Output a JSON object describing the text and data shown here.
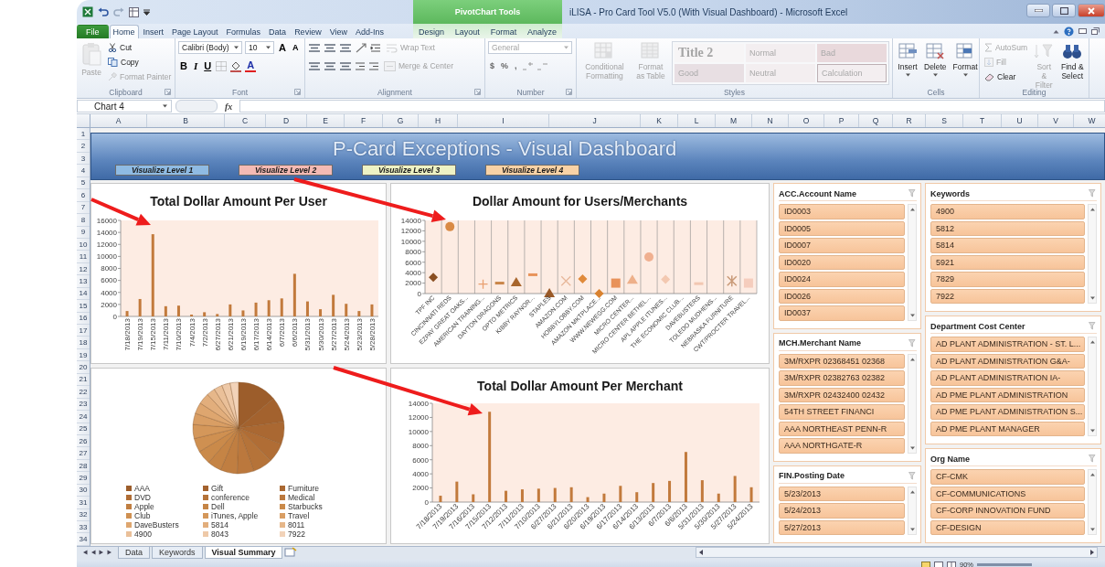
{
  "window": {
    "title": "iLISA - Pro Card Tool V5.0 (With Visual Dashboard) - Microsoft Excel",
    "context_label": "PivotChart Tools"
  },
  "ribbon_tabs": [
    {
      "label": "File",
      "kind": "file",
      "selected": false
    },
    {
      "label": "Home",
      "kind": "normal",
      "selected": true
    },
    {
      "label": "Insert",
      "kind": "normal",
      "selected": false
    },
    {
      "label": "Page Layout",
      "kind": "normal",
      "selected": false
    },
    {
      "label": "Formulas",
      "kind": "normal",
      "selected": false
    },
    {
      "label": "Data",
      "kind": "normal",
      "selected": false
    },
    {
      "label": "Review",
      "kind": "normal",
      "selected": false
    },
    {
      "label": "View",
      "kind": "normal",
      "selected": false
    },
    {
      "label": "Add-Ins",
      "kind": "normal",
      "selected": false
    },
    {
      "label": "Design",
      "kind": "context",
      "selected": false
    },
    {
      "label": "Layout",
      "kind": "context",
      "selected": false
    },
    {
      "label": "Format",
      "kind": "context",
      "selected": false
    },
    {
      "label": "Analyze",
      "kind": "context",
      "selected": false
    }
  ],
  "ribbon": {
    "clipboard": {
      "label": "Clipboard",
      "paste": {
        "label": "Paste",
        "disabled": true
      },
      "items": [
        {
          "label": "Cut",
          "disabled": false
        },
        {
          "label": "Copy",
          "disabled": false
        },
        {
          "label": "Format Painter",
          "disabled": true
        }
      ]
    },
    "font": {
      "label": "Font",
      "family": "Calibri (Body)",
      "size": "10",
      "grow_shrink": [
        "A",
        "A"
      ],
      "toggles": [
        "B",
        "I",
        "U"
      ],
      "font_color": "A"
    },
    "alignment": {
      "label": "Alignment",
      "wrap_text": {
        "label": "Wrap Text",
        "disabled": true
      },
      "merge": {
        "label": "Merge & Center",
        "disabled": true
      }
    },
    "number": {
      "label": "Number",
      "format": {
        "value": "General",
        "disabled": true
      },
      "symbols": [
        "$",
        "%",
        ","
      ]
    },
    "styles": {
      "label": "Styles",
      "buttons": [
        {
          "label": "Conditional Formatting",
          "disabled": true
        },
        {
          "label": "Format as Table",
          "disabled": true
        }
      ],
      "gallery": [
        {
          "label": "Title 2",
          "kind": "title"
        },
        {
          "label": "Normal",
          "kind": "normal"
        },
        {
          "label": "Bad",
          "kind": "bad"
        },
        {
          "label": "Good",
          "kind": "good"
        },
        {
          "label": "Neutral",
          "kind": "neutral"
        },
        {
          "label": "Calculation",
          "kind": "calculation"
        }
      ]
    },
    "cells": {
      "label": "Cells",
      "buttons": [
        "Insert",
        "Delete",
        "Format"
      ]
    },
    "editing": {
      "label": "Editing",
      "items": [
        {
          "label": "AutoSum",
          "disabled": true
        },
        {
          "label": "Fill",
          "disabled": true
        },
        {
          "label": "Clear",
          "disabled": false
        }
      ],
      "buttons": [
        {
          "label": "Sort & Filter",
          "disabled": true
        },
        {
          "label": "Find & Select",
          "disabled": false
        }
      ]
    }
  },
  "formula_bar": {
    "name_box": "Chart 4",
    "function_label": "fx"
  },
  "sheet": {
    "columns": [
      "A",
      "B",
      "C",
      "D",
      "E",
      "F",
      "G",
      "H",
      "I",
      "J",
      "K",
      "L",
      "M",
      "N",
      "O",
      "P",
      "Q",
      "R",
      "S",
      "T",
      "U",
      "V",
      "W"
    ],
    "rows": [
      "1",
      "2",
      "3",
      "4",
      "5",
      "6",
      "7",
      "8",
      "9",
      "10",
      "11",
      "12",
      "13",
      "14",
      "15",
      "16",
      "17",
      "18",
      "19",
      "20",
      "21",
      "22",
      "23",
      "24",
      "25",
      "26",
      "27",
      "28",
      "29",
      "30",
      "31",
      "32",
      "33",
      "34"
    ]
  },
  "dashboard": {
    "title": "P-Card Exceptions - Visual Dashboard",
    "level_buttons": [
      {
        "label": "Visualize Level 1",
        "color": "#8fbbe3"
      },
      {
        "label": "Visualize Level 2",
        "color": "#f4bab4"
      },
      {
        "label": "Visualize Level 3",
        "color": "#eef2c4"
      },
      {
        "label": "Visualize Level 4",
        "color": "#f8d2a6"
      }
    ],
    "user_chart": {
      "chart_data": {
        "type": "bar",
        "title": "Total Dollar Amount Per User",
        "categories": [
          "7/18/2013",
          "7/19/2013",
          "7/15/2013",
          "7/11/2013",
          "7/10/2013",
          "7/4/2013",
          "7/2/2013",
          "6/27/2013",
          "6/21/2013",
          "6/19/2013",
          "6/17/2013",
          "6/14/2013",
          "6/7/2013",
          "6/6/2013",
          "5/31/2013",
          "5/30/2013",
          "5/27/2013",
          "5/24/2013",
          "5/23/2013",
          "5/28/2013"
        ],
        "values": [
          900,
          2900,
          13700,
          1700,
          1800,
          300,
          700,
          400,
          2000,
          1000,
          2300,
          2700,
          3000,
          7100,
          2500,
          1200,
          3600,
          2100,
          900,
          2000
        ],
        "ylim": [
          0,
          16000
        ],
        "yticks": [
          0,
          2000,
          4000,
          6000,
          8000,
          10000,
          12000,
          14000,
          16000
        ]
      }
    },
    "category_pie": {
      "legend": [
        {
          "label": "AAA",
          "color": "#9c5d2b"
        },
        {
          "label": "Gift",
          "color": "#a3622e"
        },
        {
          "label": "Furniture",
          "color": "#aa6832"
        },
        {
          "label": "DVD",
          "color": "#b06d35"
        },
        {
          "label": "conference",
          "color": "#b57339"
        },
        {
          "label": "Medical",
          "color": "#bb783d"
        },
        {
          "label": "Apple",
          "color": "#c07e41"
        },
        {
          "label": "Dell",
          "color": "#c58445"
        },
        {
          "label": "Starbucks",
          "color": "#ca8a4a"
        },
        {
          "label": "Club",
          "color": "#cf9051"
        },
        {
          "label": "iTunes, Apple",
          "color": "#d4975a"
        },
        {
          "label": "Travel",
          "color": "#d99e64"
        },
        {
          "label": "DaveBusters",
          "color": "#dea66f"
        },
        {
          "label": "5814",
          "color": "#e2ae7c"
        },
        {
          "label": "8011",
          "color": "#e6b78a"
        },
        {
          "label": "4900",
          "color": "#eac099"
        },
        {
          "label": "8043",
          "color": "#eec9a8"
        },
        {
          "label": "7922",
          "color": "#f2d3b9"
        }
      ]
    },
    "merchant_scatter": {
      "chart_data": {
        "type": "scatter",
        "title": "Dollar Amount for Users/Merchants",
        "categories": [
          "TPF INC",
          "CINCINNATI REDS",
          "EZPAY GREAT OAKS...",
          "AMERICAN TRAINING...",
          "DAYTON DRAGONS",
          "OPTO METRICS",
          "KIBBY RAYNOR...",
          "STAPLES",
          "AMAZON.COM",
          "HOBBYLOBBY.COM",
          "AMAZON MKTPLACE...",
          "WWW.NEWEGG.COM",
          "MICRO CENTER...",
          "MICRO CENTER BETHEL...",
          "APL APPLE ITUNES...",
          "THE ECONOMIC CLUB...",
          "DAVEBUSTERS",
          "TOLEDO MUDHENS...",
          "NEBRASKA FURNITURE",
          "CWT/PROCTER TRAVEL..."
        ],
        "values": [
          3100,
          12800,
          null,
          1800,
          2000,
          2100,
          3600,
          0,
          2400,
          2800,
          0,
          2000,
          2600,
          7000,
          2700,
          null,
          1900,
          null,
          2400,
          2000
        ],
        "ylim": [
          0,
          14000
        ],
        "yticks": [
          0,
          2000,
          4000,
          6000,
          8000,
          10000,
          12000,
          14000
        ]
      }
    },
    "merchant_chart": {
      "chart_data": {
        "type": "bar",
        "title": "Total Dollar Amount Per Merchant",
        "categories": [
          "7/18/2013",
          "7/19/2013",
          "7/16/2013",
          "7/15/2013",
          "7/12/2013",
          "7/11/2013",
          "7/10/2013",
          "6/27/2013",
          "6/21/2013",
          "6/20/2013",
          "6/19/2013",
          "6/17/2013",
          "6/14/2013",
          "6/13/2013",
          "6/7/2013",
          "6/6/2013",
          "5/31/2013",
          "5/30/2013",
          "5/27/2013",
          "5/24/2013"
        ],
        "values": [
          900,
          2900,
          1100,
          12800,
          1600,
          1800,
          1900,
          2000,
          2100,
          700,
          1200,
          2300,
          1400,
          2700,
          3000,
          7100,
          3100,
          1200,
          3700,
          2100
        ],
        "ylim": [
          0,
          14000
        ],
        "yticks": [
          0,
          2000,
          4000,
          6000,
          8000,
          10000,
          12000,
          14000
        ]
      }
    }
  },
  "slicer_columns": [
    {
      "slicers": [
        {
          "title": "ACC.Account Name",
          "items": [
            {
              "label": "ID0003",
              "selected": true
            },
            {
              "label": "ID0005",
              "selected": true
            },
            {
              "label": "ID0007",
              "selected": true
            },
            {
              "label": "ID0020",
              "selected": true
            },
            {
              "label": "ID0024",
              "selected": true
            },
            {
              "label": "ID0026",
              "selected": true
            },
            {
              "label": "ID0037",
              "selected": true
            }
          ]
        },
        {
          "title": "MCH.Merchant Name",
          "items": [
            {
              "label": "3M/RXPR 02368451 02368",
              "selected": true
            },
            {
              "label": "3M/RXPR 02382763 02382",
              "selected": true
            },
            {
              "label": "3M/RXPR 02432400 02432",
              "selected": true
            },
            {
              "label": "54TH STREET FINANCI",
              "selected": true
            },
            {
              "label": "AAA NORTHEAST PENN-R",
              "selected": true
            },
            {
              "label": "AAA NORTHGATE-R",
              "selected": true
            }
          ]
        },
        {
          "title": "FIN.Posting Date",
          "items": [
            {
              "label": "5/23/2013",
              "selected": true
            },
            {
              "label": "5/24/2013",
              "selected": true
            },
            {
              "label": "5/27/2013",
              "selected": true
            }
          ]
        }
      ]
    },
    {
      "slicers": [
        {
          "title": "Keywords",
          "items": [
            {
              "label": "4900",
              "selected": true
            },
            {
              "label": "5812",
              "selected": true
            },
            {
              "label": "5814",
              "selected": true
            },
            {
              "label": "5921",
              "selected": true
            },
            {
              "label": "7829",
              "selected": true
            },
            {
              "label": "7922",
              "selected": true
            }
          ]
        },
        {
          "title": "Department Cost Center",
          "items": [
            {
              "label": "AD PLANT ADMINISTRATION - ST. L...",
              "selected": true
            },
            {
              "label": "AD PLANT ADMINISTRATION G&A-",
              "selected": true
            },
            {
              "label": "AD PLANT ADMINISTRATION IA-",
              "selected": true
            },
            {
              "label": "AD PME PLANT ADMINISTRATION",
              "selected": true
            },
            {
              "label": "AD PME PLANT ADMINISTRATION S...",
              "selected": true
            },
            {
              "label": "AD PME PLANT MANAGER",
              "selected": true
            }
          ]
        },
        {
          "title": "Org Name",
          "items": [
            {
              "label": "CF-CMK",
              "selected": true
            },
            {
              "label": "CF-COMMUNICATIONS",
              "selected": true
            },
            {
              "label": "CF-CORP INNOVATION FUND",
              "selected": true
            },
            {
              "label": "CF-DESIGN",
              "selected": true
            }
          ]
        }
      ]
    }
  ],
  "sheet_tabs": [
    {
      "label": "Data",
      "selected": false
    },
    {
      "label": "Keywords",
      "selected": false
    },
    {
      "label": "Visual Summary",
      "selected": true
    }
  ],
  "status_bar": {
    "zoom": "90%"
  }
}
